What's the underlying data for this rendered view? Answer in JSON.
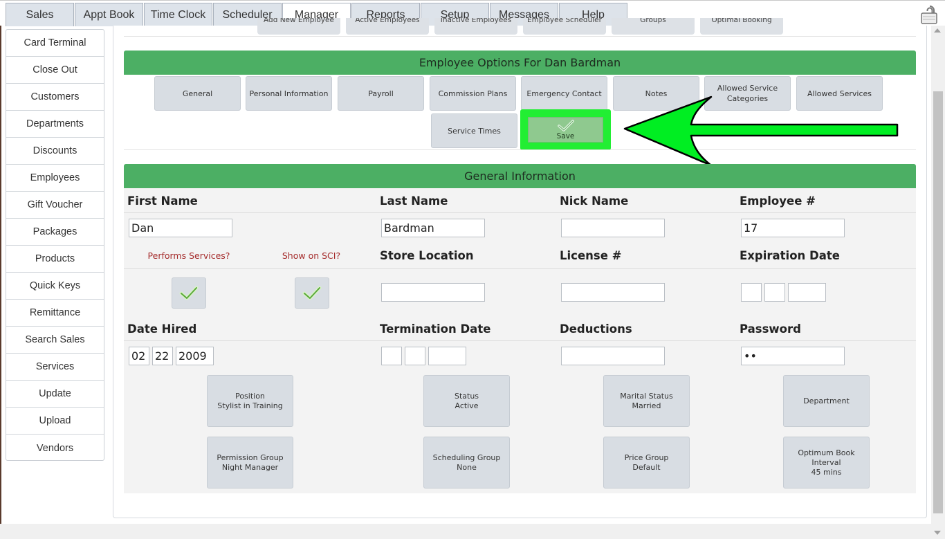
{
  "top_tabs": [
    {
      "label": "Sales",
      "active": false
    },
    {
      "label": "Appt Book",
      "active": false
    },
    {
      "label": "Time Clock",
      "active": false
    },
    {
      "label": "Scheduler",
      "active": false
    },
    {
      "label": "Manager",
      "active": true
    },
    {
      "label": "Reports",
      "active": false
    },
    {
      "label": "Setup",
      "active": false
    },
    {
      "label": "Messages",
      "active": false
    },
    {
      "label": "Help",
      "active": false
    }
  ],
  "sidebar": {
    "items": [
      "Card Terminal",
      "Close Out",
      "Customers",
      "Departments",
      "Discounts",
      "Employees",
      "Gift Voucher",
      "Packages",
      "Products",
      "Quick Keys",
      "Remittance",
      "Search Sales",
      "Services",
      "Update",
      "Upload",
      "Vendors"
    ]
  },
  "sub_tabs": [
    "Add New Employee",
    "Active Employees",
    "Inactive Employees",
    "Employee Scheduler",
    "Groups",
    "Optimal Booking"
  ],
  "options": {
    "title": "Employee Options For Dan Bardman",
    "buttons": [
      "General",
      "Personal Information",
      "Payroll",
      "Commission Plans",
      "Emergency Contact",
      "Notes",
      "Allowed Service Categories",
      "Allowed Services"
    ],
    "service_times": "Service Times",
    "save": "Save"
  },
  "general": {
    "title": "General Information",
    "labels": {
      "first_name": "First Name",
      "last_name": "Last Name",
      "nick_name": "Nick Name",
      "employee_no": "Employee #",
      "performs_services": "Performs Services?",
      "show_on_sci": "Show on SCI?",
      "store_location": "Store Location",
      "license_no": "License #",
      "expiration_date": "Expiration Date",
      "date_hired": "Date Hired",
      "termination_date": "Termination Date",
      "deductions": "Deductions",
      "password": "Password"
    },
    "values": {
      "first_name": "Dan",
      "last_name": "Bardman",
      "nick_name": "",
      "employee_no": "17",
      "store_location": "",
      "license_no": "",
      "exp_month": "",
      "exp_day": "",
      "exp_year": "",
      "hired_month": "02",
      "hired_day": "22",
      "hired_year": "2009",
      "term_month": "",
      "term_day": "",
      "term_year": "",
      "deductions": "",
      "password": "••"
    },
    "buttons": {
      "position": {
        "label": "Position",
        "value": "Stylist in Training"
      },
      "status": {
        "label": "Status",
        "value": "Active"
      },
      "marital_status": {
        "label": "Marital Status",
        "value": "Married"
      },
      "department": {
        "label": "Department",
        "value": ""
      },
      "permission_group": {
        "label": "Permission Group",
        "value": "Night Manager"
      },
      "scheduling_group": {
        "label": "Scheduling Group",
        "value": "None"
      },
      "price_group": {
        "label": "Price Group",
        "value": "Default"
      },
      "optimum_book": {
        "label": "Optimum Book Interval",
        "value": "45 mins"
      }
    }
  },
  "colors": {
    "header_green": "#4caf64",
    "highlight_green": "#22ee33",
    "arrow_green": "#00ee22",
    "label_red": "#a42a2a",
    "button_gray": "#d8dde3"
  },
  "icons": {
    "lock": "lock-icon",
    "check": "checkmark-icon",
    "annotation": "arrow-annotation"
  }
}
